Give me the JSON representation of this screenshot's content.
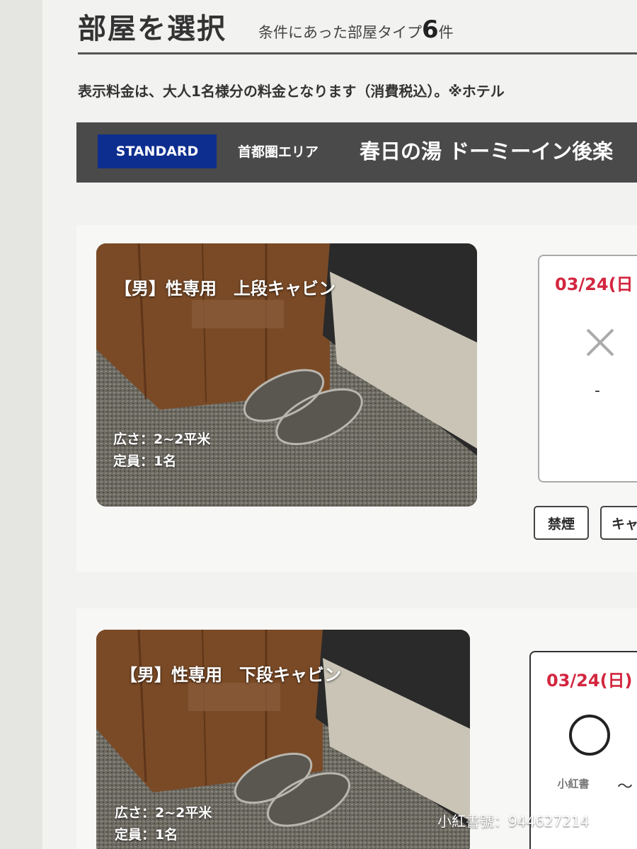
{
  "header": {
    "title": "部屋を選択",
    "count_prefix": "条件にあった部屋タイプ",
    "count_value": "6",
    "count_suffix": "件"
  },
  "notice": "表示料金は、大人1名様分の料金となります（消費税込）。※ホテル",
  "hotel": {
    "grade": "STANDARD",
    "area": "首都圏エリア",
    "name": "春日の湯 ドーミーイン後楽"
  },
  "rooms": [
    {
      "name": "【男】性専用　上段キャビン",
      "size": "広さ：2~2平米",
      "capacity": "定員：1名",
      "date": "03/24(日",
      "availability_icon": "cross-icon",
      "price": "-",
      "tags": [
        "禁煙",
        "キャ"
      ]
    },
    {
      "name": "【男】性専用　下段キャビン",
      "size": "広さ：2~2平米",
      "capacity": "定員：1名",
      "date": "03/24(日)",
      "availability_icon": "circle-icon",
      "price": "〜"
    }
  ],
  "watermark": {
    "pill": "小紅書",
    "id": "小紅書號：944627214"
  },
  "colors": {
    "badge": "#0d2e8f",
    "date": "#d3263f",
    "hotel_bar": "#4a4a4a"
  }
}
